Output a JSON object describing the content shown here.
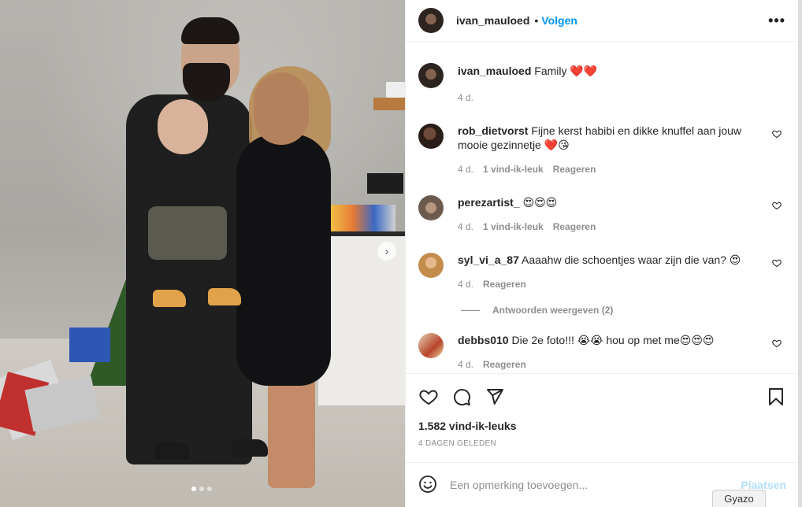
{
  "post": {
    "author": "ivan_mauloed",
    "separator": "•",
    "follow_label": "Volgen",
    "more_icon": "more-options-icon",
    "carousel": {
      "slide_count": 3,
      "active_index": 0
    }
  },
  "caption": {
    "username": "ivan_mauloed",
    "text": "Family ❤️❤️",
    "time": "4 d."
  },
  "comments": [
    {
      "username": "rob_dietvorst",
      "text": "Fijne kerst habibi en dikke knuffel aan jouw mooie gezinnetje ❤️😘",
      "time": "4 d.",
      "likes": "1 vind-ik-leuk",
      "reply": "Reageren"
    },
    {
      "username": "perezartist_",
      "text": "😍😍😍",
      "time": "4 d.",
      "likes": "1 vind-ik-leuk",
      "reply": "Reageren"
    },
    {
      "username": "syl_vi_a_87",
      "text": "Aaaahw die schoentjes waar zijn die van? 😍",
      "time": "4 d.",
      "reply": "Reageren",
      "view_replies": "Antwoorden weergeven (2)"
    },
    {
      "username": "debbs010",
      "text": "Die 2e foto!!! 😭😭  hou op met me😍😍😍",
      "time": "4 d.",
      "reply": "Reageren"
    }
  ],
  "actions": {
    "likes_count": "1.582 vind-ik-leuks",
    "posted": "4 DAGEN GELEDEN"
  },
  "add_comment": {
    "placeholder": "Een opmerking toevoegen...",
    "post_label": "Plaatsen"
  },
  "overlay": {
    "gyazo": "Gyazo"
  },
  "colors": {
    "link": "#0095f6",
    "muted": "#8e8e8e",
    "text": "#262626",
    "post_disabled": "#b2dffc"
  }
}
